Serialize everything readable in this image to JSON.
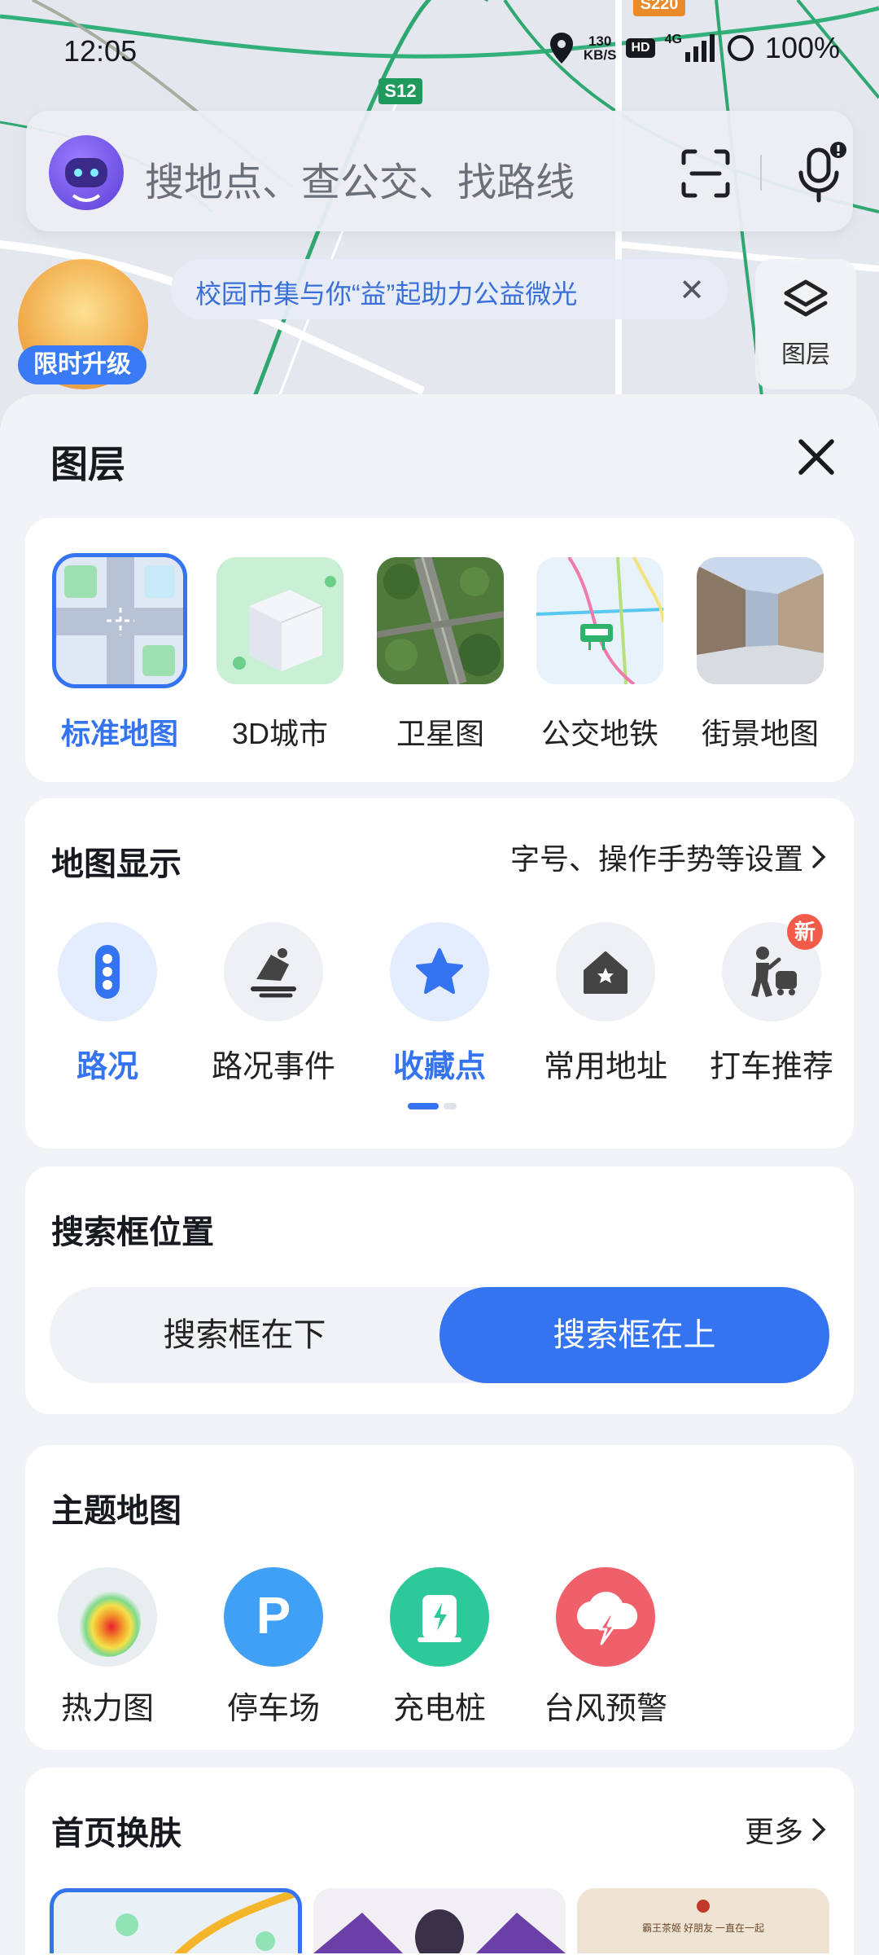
{
  "status_bar": {
    "time": "12:05",
    "net_speed_value": "130",
    "net_speed_unit": "KB/S",
    "hd": "HD",
    "network": "4G",
    "battery": "100%"
  },
  "map": {
    "road_badge_1": "S12",
    "road_badge_2": "S220"
  },
  "search": {
    "placeholder": "搜地点、查公交、找路线"
  },
  "promo": {
    "badge_label": "限时升级",
    "notice_text": "校园市集与你“益”起助力公益微光",
    "notice_close": "✕",
    "layer_button_label": "图层"
  },
  "sheet": {
    "title": "图层",
    "map_types": [
      {
        "label": "标准地图",
        "selected": true
      },
      {
        "label": "3D城市",
        "selected": false
      },
      {
        "label": "卫星图",
        "selected": false
      },
      {
        "label": "公交地铁",
        "selected": false
      },
      {
        "label": "街景地图",
        "selected": false
      }
    ],
    "map_display": {
      "title": "地图显示",
      "settings_link": "字号、操作手势等设置",
      "items": [
        {
          "label": "路况",
          "active": true
        },
        {
          "label": "路况事件",
          "active": false
        },
        {
          "label": "收藏点",
          "active": true
        },
        {
          "label": "常用地址",
          "active": false
        },
        {
          "label": "打车推荐",
          "active": false,
          "badge": "新"
        }
      ],
      "page_index": 1,
      "page_count": 2
    },
    "search_position": {
      "title": "搜索框位置",
      "options": [
        "搜索框在下",
        "搜索框在上"
      ],
      "selected": "搜索框在上"
    },
    "theme_maps": {
      "title": "主题地图",
      "items": [
        {
          "label": "热力图",
          "icon": "heatmap-icon"
        },
        {
          "label": "停车场",
          "icon": "parking-icon",
          "glyph": "P"
        },
        {
          "label": "充电桩",
          "icon": "charging-pile-icon"
        },
        {
          "label": "台风预警",
          "icon": "typhoon-warning-icon"
        }
      ]
    },
    "skins": {
      "title": "首页换肤",
      "more": "更多",
      "skin3_caption": "霸王茶姬 好朋友 一直在一起"
    }
  },
  "colors": {
    "accent": "#3574F0",
    "badge_red": "#F25A4A",
    "parking": "#3FA0F5",
    "charging": "#2EC99A",
    "typhoon": "#F0606A"
  }
}
